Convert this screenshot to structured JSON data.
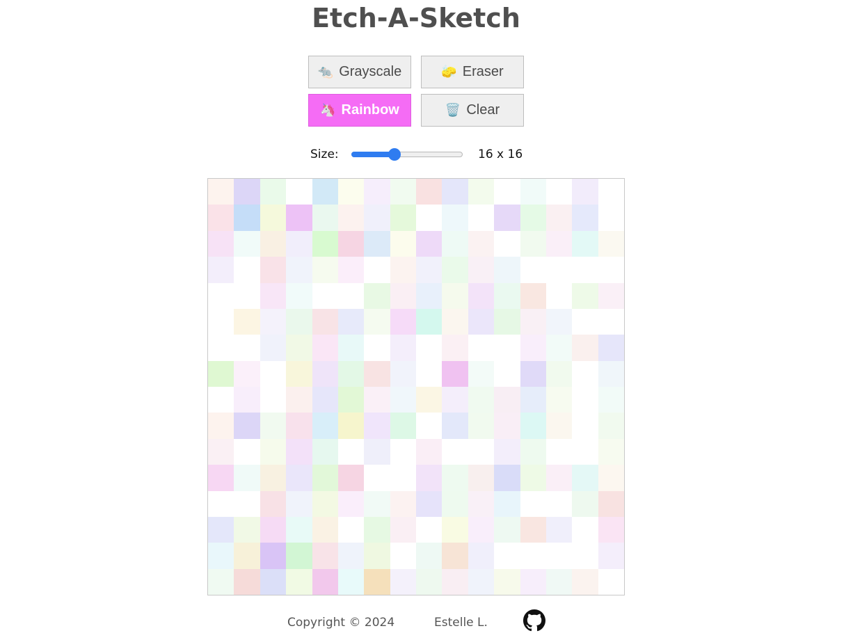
{
  "app": {
    "title": "Etch-A-Sketch"
  },
  "controls": {
    "grayscale": {
      "emoji": "🐀",
      "label": "Grayscale"
    },
    "eraser": {
      "emoji": "🧽",
      "label": "Eraser"
    },
    "rainbow": {
      "emoji": "🦄",
      "label": "Rainbow",
      "active": true
    },
    "clear": {
      "emoji": "🗑️",
      "label": "Clear"
    }
  },
  "size": {
    "label": "Size:",
    "value": 16,
    "min": 1,
    "max": 40,
    "display": "16 x 16"
  },
  "colors": {
    "active_button": "#f56cf5",
    "slider_accent": "#2f7cf0",
    "button_bg": "#efefef",
    "text": "#4f4f4f"
  },
  "grid": {
    "rows": 16,
    "cols": 16,
    "cells": [
      "#fdf3ee",
      "#dcd6f7",
      "#eafaea",
      "#ffffff",
      "#d2e9f7",
      "#fcfdee",
      "#f6eefc",
      "#f1fbf0",
      "#f9e1e1",
      "#e4e6fa",
      "#f3fbed",
      "#ffffff",
      "#f1fbf9",
      "#ffffff",
      "#f2ecfb",
      "#ffffff",
      "#fae2e8",
      "#c5ddf8",
      "#f5f9dc",
      "#edc2f6",
      "#eaf8ef",
      "#fcf2ef",
      "#f0f0fb",
      "#e5f9db",
      "#ffffff",
      "#eef8fb",
      "#ffffff",
      "#e6d9f8",
      "#e5fae6",
      "#faf0f2",
      "#e5e9fb",
      "#ffffff",
      "#f7e2f6",
      "#f1fbf9",
      "#f9f0e3",
      "#f1eefb",
      "#d8fad0",
      "#f6d5e3",
      "#dceaf8",
      "#fcfced",
      "#eedaf8",
      "#eefaf5",
      "#fbf2f2",
      "#ffffff",
      "#f1faef",
      "#faeff8",
      "#e3f9f6",
      "#fbf9f1",
      "#f3eefb",
      "#ffffff",
      "#f9e2e8",
      "#f0f3fb",
      "#f6fbef",
      "#fbeefa",
      "#ffffff",
      "#fcf3f0",
      "#f1f1fb",
      "#eafaea",
      "#f9f0f6",
      "#eef6fa",
      "#ffffff",
      "#ffffff",
      "#ffffff",
      "#ffffff",
      "#ffffff",
      "#ffffff",
      "#f8e6f7",
      "#f1fbfa",
      "#ffffff",
      "#ffffff",
      "#e8f9e4",
      "#faeff4",
      "#e8f0fb",
      "#f5faed",
      "#f3e3f9",
      "#eaf9f0",
      "#f9e7e1",
      "#ffffff",
      "#eefae8",
      "#faf0f7",
      "#ffffff",
      "#fcf5e3",
      "#f4f2fb",
      "#eaf8ec",
      "#f8e3e6",
      "#e7eafa",
      "#f5fbf0",
      "#f6dbf8",
      "#d4f8ee",
      "#fbf6ef",
      "#ebe6fa",
      "#e6f8e5",
      "#f9f0f5",
      "#f1f5fb",
      "#ffffff",
      "#ffffff",
      "#ffffff",
      "#ffffff",
      "#f0f2fb",
      "#f1f9e6",
      "#fae6f6",
      "#e8f9f8",
      "#ffffff",
      "#f4eefb",
      "#ffffff",
      "#fbf0f4",
      "#ffffff",
      "#ffffff",
      "#f9eefb",
      "#f2fbf8",
      "#faf0ee",
      "#e6e6fa",
      "#dff8d2",
      "#fbf0fa",
      "#ffffff",
      "#f8f6db",
      "#efe4f9",
      "#e3f8e6",
      "#f8e3e3",
      "#f1f3fb",
      "#ffffff",
      "#f0c2f1",
      "#f3fbf8",
      "#ffffff",
      "#e0daf8",
      "#f1faee",
      "#ffffff",
      "#f0f6fa",
      "#ffffff",
      "#f8eefb",
      "#ffffff",
      "#fbf0ee",
      "#e6e6fa",
      "#e2f8d6",
      "#faf0f7",
      "#f0f7fb",
      "#fbf6e4",
      "#f4eefb",
      "#f0faf0",
      "#f8eef4",
      "#e6edfa",
      "#f7fbf0",
      "#ffffff",
      "#f2fbf8",
      "#fdf3ee",
      "#dcd6f7",
      "#f1faf0",
      "#f8e1ec",
      "#d8eef9",
      "#f6f5cd",
      "#f0e5fb",
      "#ddf8e6",
      "#ffffff",
      "#e3e8fa",
      "#f1faef",
      "#f9eef6",
      "#dcf8f4",
      "#fbf7ef",
      "#ffffff",
      "#f1faef",
      "#faf0f4",
      "#ffffff",
      "#f6fbec",
      "#f3e1f9",
      "#e6f8ef",
      "#ffffff",
      "#efeffa",
      "#ffffff",
      "#faeef6",
      "#ffffff",
      "#ffffff",
      "#f3eefb",
      "#eefaef",
      "#ffffff",
      "#ffffff",
      "#f7fbf0",
      "#f7d7f3",
      "#f0faf8",
      "#f8f1e1",
      "#eae6fa",
      "#e2f8d9",
      "#f6d5e3",
      "#ffffff",
      "#ffffff",
      "#f2e3f9",
      "#eefaf0",
      "#f8efee",
      "#d9dcf8",
      "#eefae6",
      "#faeff7",
      "#e4f8f6",
      "#fcf7f0",
      "#ffffff",
      "#ffffff",
      "#f8e1e6",
      "#f0f3fb",
      "#f3f9e3",
      "#faeefb",
      "#f1faf6",
      "#fcf2f1",
      "#e6e3fa",
      "#eefaef",
      "#f9f0f7",
      "#e8f5fb",
      "#ffffff",
      "#ffffff",
      "#eef9ef",
      "#f8e2e1",
      "#e4e7fa",
      "#f1f9e6",
      "#f6dbf5",
      "#e8faf7",
      "#faf2e4",
      "#ffffff",
      "#e6f9e3",
      "#faeff4",
      "#ffffff",
      "#f9fbe3",
      "#f9eefb",
      "#eef9f2",
      "#f9e6e1",
      "#f0effb",
      "#ffffff",
      "#fae4f4",
      "#e9f7fb",
      "#f7f1d9",
      "#d9c4f6",
      "#d2f6d4",
      "#f8e3e8",
      "#eff3fb",
      "#eff8e1",
      "#ffffff",
      "#eef9f4",
      "#f7e4d6",
      "#f0effb",
      "#ffffff",
      "#ffffff",
      "#ffffff",
      "#ffffff",
      "#f4eefb",
      "#f0faf2",
      "#f6dbd9",
      "#dbdff8",
      "#f1fae4",
      "#f2c8ec",
      "#e8fafa",
      "#f5e0bb",
      "#f4f1fb",
      "#eef9ef",
      "#f9eef3",
      "#f0f3fb",
      "#f7faeb",
      "#f7eefb",
      "#f0f9f5",
      "#fbf3ef",
      "#ffffff"
    ]
  },
  "footer": {
    "copyright": "Copyright © 2024",
    "author": "Estelle L.",
    "github_icon": "github-icon"
  }
}
